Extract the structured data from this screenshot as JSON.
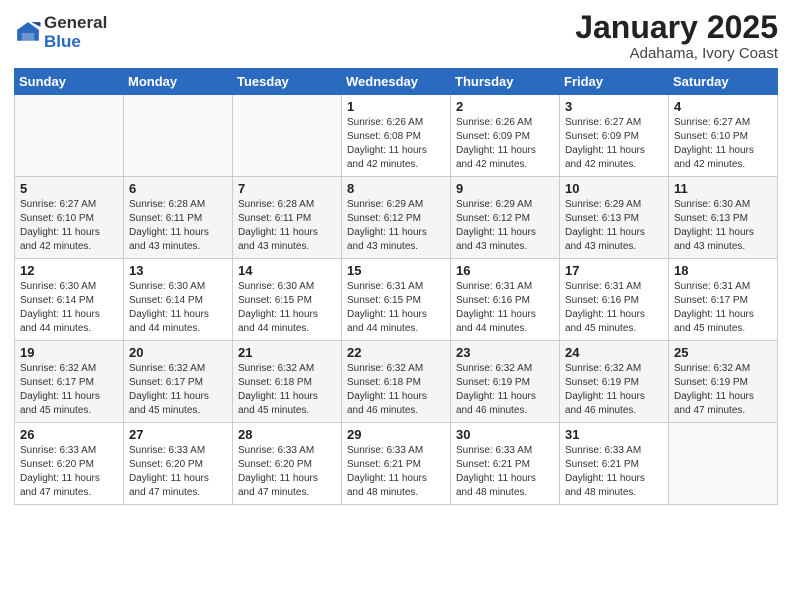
{
  "logo": {
    "general": "General",
    "blue": "Blue"
  },
  "title": "January 2025",
  "location": "Adahama, Ivory Coast",
  "days_of_week": [
    "Sunday",
    "Monday",
    "Tuesday",
    "Wednesday",
    "Thursday",
    "Friday",
    "Saturday"
  ],
  "weeks": [
    [
      {
        "day": "",
        "info": ""
      },
      {
        "day": "",
        "info": ""
      },
      {
        "day": "",
        "info": ""
      },
      {
        "day": "1",
        "info": "Sunrise: 6:26 AM\nSunset: 6:08 PM\nDaylight: 11 hours and 42 minutes."
      },
      {
        "day": "2",
        "info": "Sunrise: 6:26 AM\nSunset: 6:09 PM\nDaylight: 11 hours and 42 minutes."
      },
      {
        "day": "3",
        "info": "Sunrise: 6:27 AM\nSunset: 6:09 PM\nDaylight: 11 hours and 42 minutes."
      },
      {
        "day": "4",
        "info": "Sunrise: 6:27 AM\nSunset: 6:10 PM\nDaylight: 11 hours and 42 minutes."
      }
    ],
    [
      {
        "day": "5",
        "info": "Sunrise: 6:27 AM\nSunset: 6:10 PM\nDaylight: 11 hours and 42 minutes."
      },
      {
        "day": "6",
        "info": "Sunrise: 6:28 AM\nSunset: 6:11 PM\nDaylight: 11 hours and 43 minutes."
      },
      {
        "day": "7",
        "info": "Sunrise: 6:28 AM\nSunset: 6:11 PM\nDaylight: 11 hours and 43 minutes."
      },
      {
        "day": "8",
        "info": "Sunrise: 6:29 AM\nSunset: 6:12 PM\nDaylight: 11 hours and 43 minutes."
      },
      {
        "day": "9",
        "info": "Sunrise: 6:29 AM\nSunset: 6:12 PM\nDaylight: 11 hours and 43 minutes."
      },
      {
        "day": "10",
        "info": "Sunrise: 6:29 AM\nSunset: 6:13 PM\nDaylight: 11 hours and 43 minutes."
      },
      {
        "day": "11",
        "info": "Sunrise: 6:30 AM\nSunset: 6:13 PM\nDaylight: 11 hours and 43 minutes."
      }
    ],
    [
      {
        "day": "12",
        "info": "Sunrise: 6:30 AM\nSunset: 6:14 PM\nDaylight: 11 hours and 44 minutes."
      },
      {
        "day": "13",
        "info": "Sunrise: 6:30 AM\nSunset: 6:14 PM\nDaylight: 11 hours and 44 minutes."
      },
      {
        "day": "14",
        "info": "Sunrise: 6:30 AM\nSunset: 6:15 PM\nDaylight: 11 hours and 44 minutes."
      },
      {
        "day": "15",
        "info": "Sunrise: 6:31 AM\nSunset: 6:15 PM\nDaylight: 11 hours and 44 minutes."
      },
      {
        "day": "16",
        "info": "Sunrise: 6:31 AM\nSunset: 6:16 PM\nDaylight: 11 hours and 44 minutes."
      },
      {
        "day": "17",
        "info": "Sunrise: 6:31 AM\nSunset: 6:16 PM\nDaylight: 11 hours and 45 minutes."
      },
      {
        "day": "18",
        "info": "Sunrise: 6:31 AM\nSunset: 6:17 PM\nDaylight: 11 hours and 45 minutes."
      }
    ],
    [
      {
        "day": "19",
        "info": "Sunrise: 6:32 AM\nSunset: 6:17 PM\nDaylight: 11 hours and 45 minutes."
      },
      {
        "day": "20",
        "info": "Sunrise: 6:32 AM\nSunset: 6:17 PM\nDaylight: 11 hours and 45 minutes."
      },
      {
        "day": "21",
        "info": "Sunrise: 6:32 AM\nSunset: 6:18 PM\nDaylight: 11 hours and 45 minutes."
      },
      {
        "day": "22",
        "info": "Sunrise: 6:32 AM\nSunset: 6:18 PM\nDaylight: 11 hours and 46 minutes."
      },
      {
        "day": "23",
        "info": "Sunrise: 6:32 AM\nSunset: 6:19 PM\nDaylight: 11 hours and 46 minutes."
      },
      {
        "day": "24",
        "info": "Sunrise: 6:32 AM\nSunset: 6:19 PM\nDaylight: 11 hours and 46 minutes."
      },
      {
        "day": "25",
        "info": "Sunrise: 6:32 AM\nSunset: 6:19 PM\nDaylight: 11 hours and 47 minutes."
      }
    ],
    [
      {
        "day": "26",
        "info": "Sunrise: 6:33 AM\nSunset: 6:20 PM\nDaylight: 11 hours and 47 minutes."
      },
      {
        "day": "27",
        "info": "Sunrise: 6:33 AM\nSunset: 6:20 PM\nDaylight: 11 hours and 47 minutes."
      },
      {
        "day": "28",
        "info": "Sunrise: 6:33 AM\nSunset: 6:20 PM\nDaylight: 11 hours and 47 minutes."
      },
      {
        "day": "29",
        "info": "Sunrise: 6:33 AM\nSunset: 6:21 PM\nDaylight: 11 hours and 48 minutes."
      },
      {
        "day": "30",
        "info": "Sunrise: 6:33 AM\nSunset: 6:21 PM\nDaylight: 11 hours and 48 minutes."
      },
      {
        "day": "31",
        "info": "Sunrise: 6:33 AM\nSunset: 6:21 PM\nDaylight: 11 hours and 48 minutes."
      },
      {
        "day": "",
        "info": ""
      }
    ]
  ]
}
